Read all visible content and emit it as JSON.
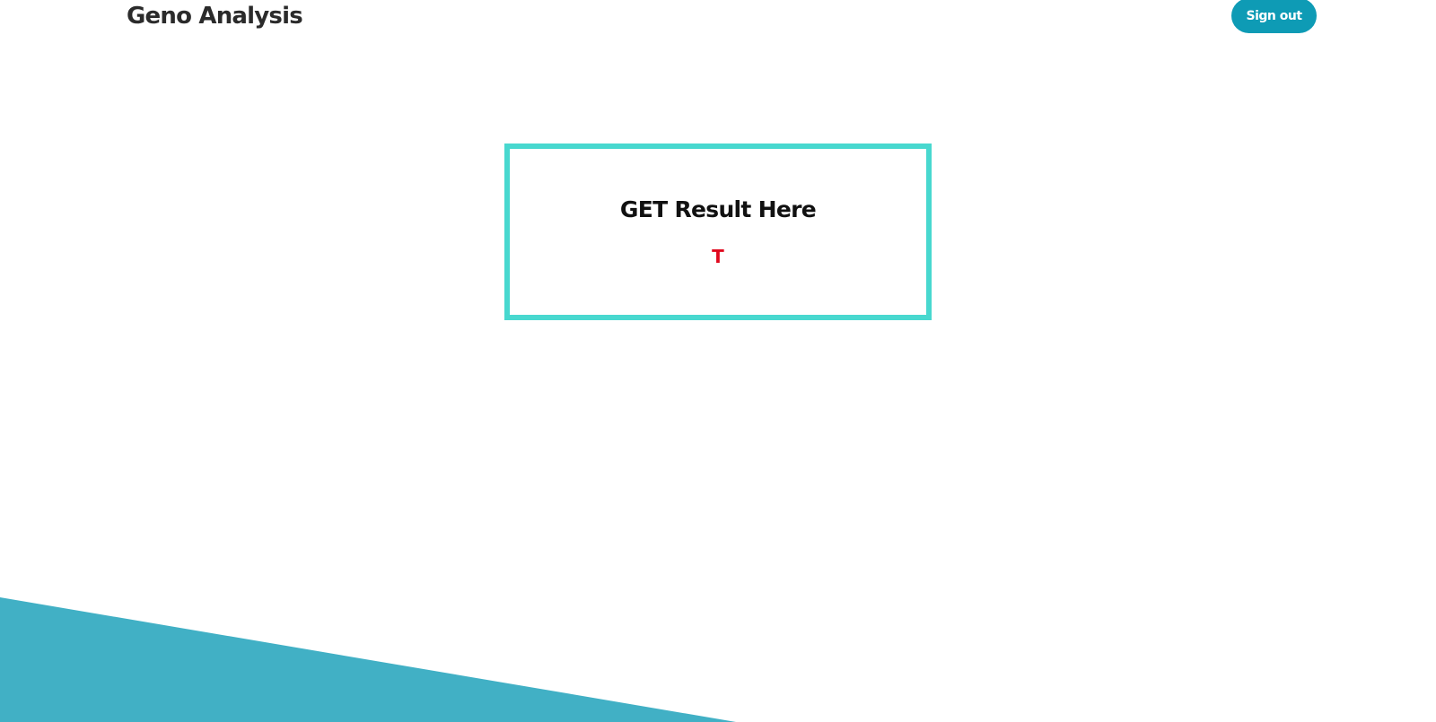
{
  "header": {
    "brand": "Geno Analysis",
    "signout_label": "Sign out"
  },
  "result": {
    "title": "GET Result Here",
    "value": "T"
  },
  "colors": {
    "accent_button": "#0e9bb5",
    "box_border": "#48d8cf",
    "result_value": "#e0081d",
    "decor_shape": "#41b0c5"
  }
}
